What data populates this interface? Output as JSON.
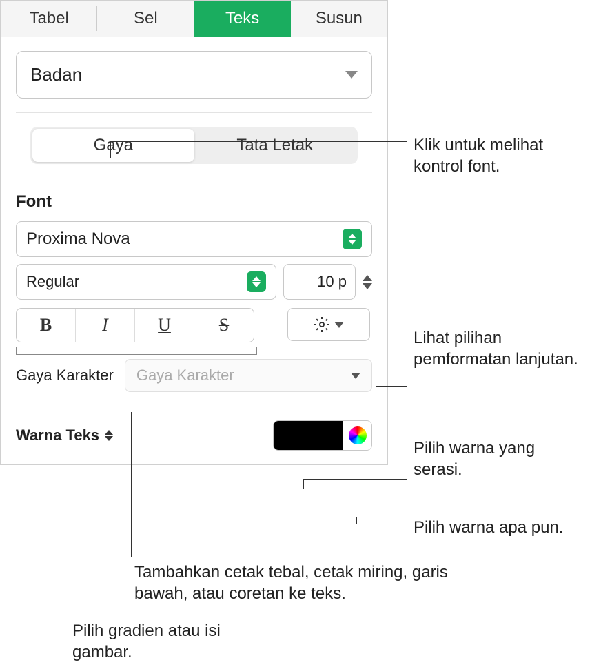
{
  "tabs": {
    "tabel": "Tabel",
    "sel": "Sel",
    "teks": "Teks",
    "susun": "Susun"
  },
  "paragraph_style": "Badan",
  "subtabs": {
    "gaya": "Gaya",
    "tataletak": "Tata Letak"
  },
  "font": {
    "section_label": "Font",
    "family": "Proxima Nova",
    "weight": "Regular",
    "size": "10 p",
    "bold": "B",
    "italic": "I",
    "underline": "U",
    "strike": "S"
  },
  "char_style": {
    "label": "Gaya Karakter",
    "placeholder": "Gaya Karakter"
  },
  "text_color": {
    "label": "Warna Teks",
    "value": "#000000"
  },
  "callouts": {
    "font_controls": "Klik untuk melihat kontrol font.",
    "advanced": "Lihat pilihan pemformatan lanjutan.",
    "matching_color": "Pilih warna yang serasi.",
    "any_color": "Pilih warna apa pun.",
    "bius": "Tambahkan cetak tebal, cetak miring, garis bawah, atau coretan ke teks.",
    "gradient": "Pilih gradien atau isi gambar."
  }
}
